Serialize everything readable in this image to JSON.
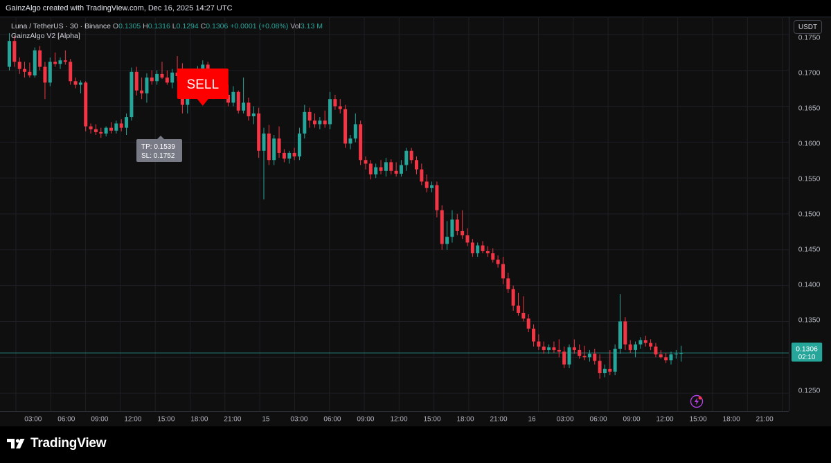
{
  "caption": "GainzAlgo created with TradingView.com, Dec 16, 2025 14:27 UTC",
  "legend": {
    "symbol": "Luna / TetherUS · 30 · Binance",
    "o_label": "O",
    "o": "0.1305",
    "h_label": "H",
    "h": "0.1316",
    "l_label": "L",
    "l": "0.1294",
    "c_label": "C",
    "c": "0.1306",
    "change": "+0.0001 (+0.08%)",
    "vol_label": "Vol",
    "vol": "3.13 M",
    "indicator": "GainzAlgo V2 [Alpha]"
  },
  "currency_button": "USDT",
  "brand": "TradingView",
  "colors": {
    "up": "#26a69a",
    "down": "#f23645",
    "sell": "#ff0000",
    "price_line": "#26a69a",
    "background": "#0f0f0f",
    "bolt": "#e040fb"
  },
  "icons": {
    "brand": "tradingview-logo-icon",
    "alert": "lightning-bolt-icon"
  },
  "chart_data": {
    "type": "candlestick",
    "y_ticks": [
      "0.1250",
      "0.1300",
      "0.1350",
      "0.1400",
      "0.1450",
      "0.1500",
      "0.1550",
      "0.1600",
      "0.1650",
      "0.1700",
      "0.1750"
    ],
    "ylim": [
      0.1225,
      0.1775
    ],
    "x_ticks": [
      "03:00",
      "06:00",
      "09:00",
      "12:00",
      "15:00",
      "18:00",
      "21:00",
      "15",
      "03:00",
      "06:00",
      "09:00",
      "12:00",
      "15:00",
      "18:00",
      "21:00",
      "16",
      "03:00",
      "06:00",
      "09:00",
      "12:00",
      "15:00",
      "18:00",
      "21:00"
    ],
    "grid": true,
    "current_price": {
      "value": 0.1306,
      "label": "0.1306",
      "countdown": "02:10"
    },
    "sell_signal": {
      "label": "SELL",
      "tp": "TP: 0.1539",
      "sl": "SL: 0.1752",
      "candle_index": 38
    },
    "candles": [
      {
        "o": 0.1705,
        "h": 0.1752,
        "l": 0.17,
        "c": 0.1741
      },
      {
        "o": 0.1741,
        "h": 0.1748,
        "l": 0.1705,
        "c": 0.1712
      },
      {
        "o": 0.1712,
        "h": 0.1718,
        "l": 0.1695,
        "c": 0.1702
      },
      {
        "o": 0.1702,
        "h": 0.1712,
        "l": 0.169,
        "c": 0.1698
      },
      {
        "o": 0.1698,
        "h": 0.1711,
        "l": 0.169,
        "c": 0.1693
      },
      {
        "o": 0.1693,
        "h": 0.1732,
        "l": 0.169,
        "c": 0.1728
      },
      {
        "o": 0.1728,
        "h": 0.1734,
        "l": 0.17,
        "c": 0.1705
      },
      {
        "o": 0.1705,
        "h": 0.1712,
        "l": 0.166,
        "c": 0.1683
      },
      {
        "o": 0.1683,
        "h": 0.1718,
        "l": 0.1678,
        "c": 0.1712
      },
      {
        "o": 0.1712,
        "h": 0.1725,
        "l": 0.1705,
        "c": 0.1709
      },
      {
        "o": 0.1709,
        "h": 0.1718,
        "l": 0.1702,
        "c": 0.1714
      },
      {
        "o": 0.1714,
        "h": 0.1728,
        "l": 0.1708,
        "c": 0.1712
      },
      {
        "o": 0.1712,
        "h": 0.1716,
        "l": 0.168,
        "c": 0.1685
      },
      {
        "o": 0.1685,
        "h": 0.169,
        "l": 0.1675,
        "c": 0.168
      },
      {
        "o": 0.168,
        "h": 0.1686,
        "l": 0.1668,
        "c": 0.1683
      },
      {
        "o": 0.1683,
        "h": 0.1685,
        "l": 0.1615,
        "c": 0.1622
      },
      {
        "o": 0.1622,
        "h": 0.1626,
        "l": 0.1612,
        "c": 0.1618
      },
      {
        "o": 0.1618,
        "h": 0.1625,
        "l": 0.161,
        "c": 0.1614
      },
      {
        "o": 0.1614,
        "h": 0.162,
        "l": 0.1606,
        "c": 0.1612
      },
      {
        "o": 0.1612,
        "h": 0.1622,
        "l": 0.1608,
        "c": 0.162
      },
      {
        "o": 0.162,
        "h": 0.1628,
        "l": 0.1612,
        "c": 0.1616
      },
      {
        "o": 0.1616,
        "h": 0.163,
        "l": 0.1612,
        "c": 0.1626
      },
      {
        "o": 0.1626,
        "h": 0.1632,
        "l": 0.1615,
        "c": 0.162
      },
      {
        "o": 0.162,
        "h": 0.164,
        "l": 0.161,
        "c": 0.1635
      },
      {
        "o": 0.1635,
        "h": 0.1704,
        "l": 0.163,
        "c": 0.1698
      },
      {
        "o": 0.1698,
        "h": 0.1705,
        "l": 0.1665,
        "c": 0.1672
      },
      {
        "o": 0.1672,
        "h": 0.169,
        "l": 0.166,
        "c": 0.1668
      },
      {
        "o": 0.1668,
        "h": 0.1696,
        "l": 0.1655,
        "c": 0.169
      },
      {
        "o": 0.169,
        "h": 0.17,
        "l": 0.168,
        "c": 0.1685
      },
      {
        "o": 0.1685,
        "h": 0.17,
        "l": 0.168,
        "c": 0.1695
      },
      {
        "o": 0.1695,
        "h": 0.1712,
        "l": 0.1688,
        "c": 0.169
      },
      {
        "o": 0.169,
        "h": 0.17,
        "l": 0.168,
        "c": 0.1683
      },
      {
        "o": 0.1683,
        "h": 0.1702,
        "l": 0.1675,
        "c": 0.1697
      },
      {
        "o": 0.1697,
        "h": 0.172,
        "l": 0.1685,
        "c": 0.1692
      },
      {
        "o": 0.1692,
        "h": 0.171,
        "l": 0.164,
        "c": 0.1652
      },
      {
        "o": 0.1652,
        "h": 0.169,
        "l": 0.164,
        "c": 0.1682
      },
      {
        "o": 0.1682,
        "h": 0.17,
        "l": 0.167,
        "c": 0.1696
      },
      {
        "o": 0.1696,
        "h": 0.1706,
        "l": 0.169,
        "c": 0.1702
      },
      {
        "o": 0.1702,
        "h": 0.1714,
        "l": 0.1695,
        "c": 0.1708
      },
      {
        "o": 0.1708,
        "h": 0.1712,
        "l": 0.1665,
        "c": 0.167
      },
      {
        "o": 0.167,
        "h": 0.1675,
        "l": 0.166,
        "c": 0.1672
      },
      {
        "o": 0.1672,
        "h": 0.168,
        "l": 0.1665,
        "c": 0.167
      },
      {
        "o": 0.167,
        "h": 0.1695,
        "l": 0.1662,
        "c": 0.1666
      },
      {
        "o": 0.1666,
        "h": 0.168,
        "l": 0.165,
        "c": 0.1655
      },
      {
        "o": 0.1655,
        "h": 0.1678,
        "l": 0.165,
        "c": 0.167
      },
      {
        "o": 0.167,
        "h": 0.1672,
        "l": 0.164,
        "c": 0.1644
      },
      {
        "o": 0.1644,
        "h": 0.169,
        "l": 0.164,
        "c": 0.1655
      },
      {
        "o": 0.1655,
        "h": 0.1662,
        "l": 0.163,
        "c": 0.1636
      },
      {
        "o": 0.1636,
        "h": 0.165,
        "l": 0.1625,
        "c": 0.164
      },
      {
        "o": 0.164,
        "h": 0.1648,
        "l": 0.1578,
        "c": 0.1588
      },
      {
        "o": 0.1588,
        "h": 0.162,
        "l": 0.152,
        "c": 0.1612
      },
      {
        "o": 0.1612,
        "h": 0.1624,
        "l": 0.1568,
        "c": 0.1575
      },
      {
        "o": 0.1575,
        "h": 0.161,
        "l": 0.1568,
        "c": 0.1605
      },
      {
        "o": 0.1605,
        "h": 0.1622,
        "l": 0.1578,
        "c": 0.1585
      },
      {
        "o": 0.1585,
        "h": 0.159,
        "l": 0.1572,
        "c": 0.1577
      },
      {
        "o": 0.1577,
        "h": 0.1588,
        "l": 0.157,
        "c": 0.1585
      },
      {
        "o": 0.1585,
        "h": 0.1592,
        "l": 0.1575,
        "c": 0.158
      },
      {
        "o": 0.158,
        "h": 0.162,
        "l": 0.1575,
        "c": 0.1612
      },
      {
        "o": 0.1612,
        "h": 0.1652,
        "l": 0.1605,
        "c": 0.1642
      },
      {
        "o": 0.1642,
        "h": 0.1648,
        "l": 0.162,
        "c": 0.163
      },
      {
        "o": 0.163,
        "h": 0.164,
        "l": 0.162,
        "c": 0.1625
      },
      {
        "o": 0.1625,
        "h": 0.1635,
        "l": 0.1618,
        "c": 0.163
      },
      {
        "o": 0.163,
        "h": 0.1644,
        "l": 0.162,
        "c": 0.1625
      },
      {
        "o": 0.1625,
        "h": 0.167,
        "l": 0.1618,
        "c": 0.166
      },
      {
        "o": 0.166,
        "h": 0.1666,
        "l": 0.1645,
        "c": 0.165
      },
      {
        "o": 0.165,
        "h": 0.166,
        "l": 0.164,
        "c": 0.1646
      },
      {
        "o": 0.1646,
        "h": 0.1652,
        "l": 0.1592,
        "c": 0.1598
      },
      {
        "o": 0.1598,
        "h": 0.161,
        "l": 0.159,
        "c": 0.1605
      },
      {
        "o": 0.1605,
        "h": 0.164,
        "l": 0.16,
        "c": 0.1625
      },
      {
        "o": 0.1625,
        "h": 0.163,
        "l": 0.1568,
        "c": 0.1575
      },
      {
        "o": 0.1575,
        "h": 0.158,
        "l": 0.1562,
        "c": 0.157
      },
      {
        "o": 0.157,
        "h": 0.1575,
        "l": 0.1548,
        "c": 0.1555
      },
      {
        "o": 0.1555,
        "h": 0.157,
        "l": 0.155,
        "c": 0.1565
      },
      {
        "o": 0.1565,
        "h": 0.1575,
        "l": 0.1555,
        "c": 0.156
      },
      {
        "o": 0.156,
        "h": 0.1578,
        "l": 0.1552,
        "c": 0.1572
      },
      {
        "o": 0.1572,
        "h": 0.1576,
        "l": 0.1555,
        "c": 0.156
      },
      {
        "o": 0.156,
        "h": 0.1572,
        "l": 0.1552,
        "c": 0.1556
      },
      {
        "o": 0.1556,
        "h": 0.1575,
        "l": 0.1552,
        "c": 0.1568
      },
      {
        "o": 0.1568,
        "h": 0.1592,
        "l": 0.156,
        "c": 0.1588
      },
      {
        "o": 0.1588,
        "h": 0.1592,
        "l": 0.157,
        "c": 0.1575
      },
      {
        "o": 0.1575,
        "h": 0.158,
        "l": 0.1555,
        "c": 0.1562
      },
      {
        "o": 0.1562,
        "h": 0.157,
        "l": 0.154,
        "c": 0.1545
      },
      {
        "o": 0.1545,
        "h": 0.1555,
        "l": 0.153,
        "c": 0.1536
      },
      {
        "o": 0.1536,
        "h": 0.1545,
        "l": 0.153,
        "c": 0.154
      },
      {
        "o": 0.154,
        "h": 0.1545,
        "l": 0.1495,
        "c": 0.1505
      },
      {
        "o": 0.1505,
        "h": 0.1512,
        "l": 0.145,
        "c": 0.1458
      },
      {
        "o": 0.1458,
        "h": 0.149,
        "l": 0.145,
        "c": 0.1468
      },
      {
        "o": 0.1468,
        "h": 0.1505,
        "l": 0.146,
        "c": 0.1492
      },
      {
        "o": 0.1492,
        "h": 0.15,
        "l": 0.147,
        "c": 0.1476
      },
      {
        "o": 0.1476,
        "h": 0.1505,
        "l": 0.1465,
        "c": 0.147
      },
      {
        "o": 0.147,
        "h": 0.148,
        "l": 0.1455,
        "c": 0.146
      },
      {
        "o": 0.146,
        "h": 0.1465,
        "l": 0.144,
        "c": 0.1445
      },
      {
        "o": 0.1445,
        "h": 0.146,
        "l": 0.144,
        "c": 0.1456
      },
      {
        "o": 0.1456,
        "h": 0.1462,
        "l": 0.1445,
        "c": 0.1448
      },
      {
        "o": 0.1448,
        "h": 0.1455,
        "l": 0.144,
        "c": 0.1445
      },
      {
        "o": 0.1445,
        "h": 0.1452,
        "l": 0.1432,
        "c": 0.1436
      },
      {
        "o": 0.1436,
        "h": 0.1442,
        "l": 0.1425,
        "c": 0.143
      },
      {
        "o": 0.143,
        "h": 0.144,
        "l": 0.1402,
        "c": 0.141
      },
      {
        "o": 0.141,
        "h": 0.1418,
        "l": 0.139,
        "c": 0.1395
      },
      {
        "o": 0.1395,
        "h": 0.14,
        "l": 0.1365,
        "c": 0.1372
      },
      {
        "o": 0.1372,
        "h": 0.139,
        "l": 0.1358,
        "c": 0.1362
      },
      {
        "o": 0.1362,
        "h": 0.1385,
        "l": 0.135,
        "c": 0.1354
      },
      {
        "o": 0.1354,
        "h": 0.136,
        "l": 0.1335,
        "c": 0.134
      },
      {
        "o": 0.134,
        "h": 0.1346,
        "l": 0.1315,
        "c": 0.1322
      },
      {
        "o": 0.1322,
        "h": 0.1332,
        "l": 0.131,
        "c": 0.1315
      },
      {
        "o": 0.1315,
        "h": 0.1322,
        "l": 0.1305,
        "c": 0.131
      },
      {
        "o": 0.131,
        "h": 0.1318,
        "l": 0.1305,
        "c": 0.1314
      },
      {
        "o": 0.1314,
        "h": 0.1322,
        "l": 0.1306,
        "c": 0.131
      },
      {
        "o": 0.131,
        "h": 0.1325,
        "l": 0.13,
        "c": 0.1308
      },
      {
        "o": 0.1308,
        "h": 0.1315,
        "l": 0.1285,
        "c": 0.129
      },
      {
        "o": 0.129,
        "h": 0.1318,
        "l": 0.1285,
        "c": 0.1314
      },
      {
        "o": 0.1314,
        "h": 0.1325,
        "l": 0.1305,
        "c": 0.131
      },
      {
        "o": 0.131,
        "h": 0.1318,
        "l": 0.1298,
        "c": 0.1302
      },
      {
        "o": 0.1302,
        "h": 0.1316,
        "l": 0.1296,
        "c": 0.13
      },
      {
        "o": 0.13,
        "h": 0.131,
        "l": 0.1294,
        "c": 0.1305
      },
      {
        "o": 0.1305,
        "h": 0.1312,
        "l": 0.129,
        "c": 0.1295
      },
      {
        "o": 0.1295,
        "h": 0.1304,
        "l": 0.127,
        "c": 0.1278
      },
      {
        "o": 0.1278,
        "h": 0.129,
        "l": 0.1272,
        "c": 0.1284
      },
      {
        "o": 0.1284,
        "h": 0.131,
        "l": 0.1275,
        "c": 0.128
      },
      {
        "o": 0.128,
        "h": 0.1318,
        "l": 0.1275,
        "c": 0.1312
      },
      {
        "o": 0.1312,
        "h": 0.1388,
        "l": 0.1305,
        "c": 0.135
      },
      {
        "o": 0.135,
        "h": 0.1356,
        "l": 0.131,
        "c": 0.1318
      },
      {
        "o": 0.1318,
        "h": 0.1324,
        "l": 0.1306,
        "c": 0.131
      },
      {
        "o": 0.131,
        "h": 0.1322,
        "l": 0.13,
        "c": 0.1318
      },
      {
        "o": 0.1318,
        "h": 0.1328,
        "l": 0.1312,
        "c": 0.1324
      },
      {
        "o": 0.1324,
        "h": 0.133,
        "l": 0.1315,
        "c": 0.132
      },
      {
        "o": 0.132,
        "h": 0.1325,
        "l": 0.131,
        "c": 0.1315
      },
      {
        "o": 0.1315,
        "h": 0.132,
        "l": 0.13,
        "c": 0.1304
      },
      {
        "o": 0.1304,
        "h": 0.131,
        "l": 0.1298,
        "c": 0.13
      },
      {
        "o": 0.13,
        "h": 0.1306,
        "l": 0.1292,
        "c": 0.1296
      },
      {
        "o": 0.1296,
        "h": 0.1308,
        "l": 0.129,
        "c": 0.1304
      },
      {
        "o": 0.1304,
        "h": 0.131,
        "l": 0.1298,
        "c": 0.1305
      },
      {
        "o": 0.1305,
        "h": 0.1316,
        "l": 0.1294,
        "c": 0.1306
      }
    ]
  }
}
